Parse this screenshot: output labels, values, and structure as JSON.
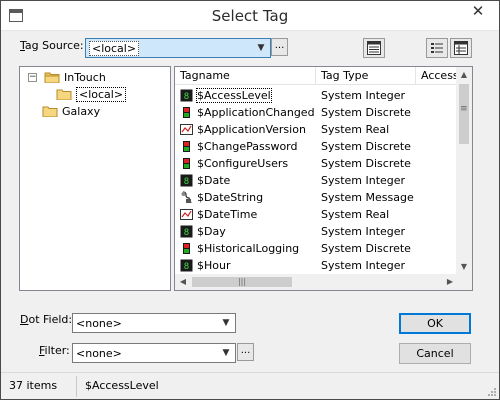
{
  "window": {
    "title": "Select Tag",
    "close_glyph": "✕"
  },
  "tag_source": {
    "label_prefix": "T",
    "label_rest": "ag Source:",
    "value": "<local>",
    "browse_label": "..."
  },
  "tree": {
    "items": [
      {
        "label": "InTouch",
        "expander": "−",
        "icon": "folder-open-icon"
      },
      {
        "label": "<local>",
        "icon": "folder-icon",
        "selected": true
      },
      {
        "label": "Galaxy",
        "icon": "folder-icon"
      }
    ]
  },
  "list": {
    "columns": [
      "Tagname",
      "Tag Type",
      "Access"
    ],
    "rows": [
      {
        "name": "$AccessLevel",
        "type": "System Integer",
        "icon": "integer-tag-icon"
      },
      {
        "name": "$ApplicationChanged",
        "type": "System Discrete",
        "icon": "discrete-tag-icon"
      },
      {
        "name": "$ApplicationVersion",
        "type": "System Real",
        "icon": "real-tag-icon"
      },
      {
        "name": "$ChangePassword",
        "type": "System Discrete",
        "icon": "discrete-tag-icon"
      },
      {
        "name": "$ConfigureUsers",
        "type": "System Discrete",
        "icon": "discrete-tag-icon"
      },
      {
        "name": "$Date",
        "type": "System Integer",
        "icon": "integer-tag-icon"
      },
      {
        "name": "$DateString",
        "type": "System Message",
        "icon": "message-tag-icon"
      },
      {
        "name": "$DateTime",
        "type": "System Real",
        "icon": "real-tag-icon"
      },
      {
        "name": "$Day",
        "type": "System Integer",
        "icon": "integer-tag-icon"
      },
      {
        "name": "$HistoricalLogging",
        "type": "System Discrete",
        "icon": "discrete-tag-icon"
      },
      {
        "name": "$Hour",
        "type": "System Integer",
        "icon": "integer-tag-icon"
      }
    ],
    "selected_index": 0
  },
  "dot_field": {
    "label_prefix": "D",
    "label_rest": "ot Field:",
    "value": "<none>"
  },
  "filter": {
    "label_prefix": "F",
    "label_rest": "ilter:",
    "value": "<none>",
    "browse_label": "..."
  },
  "buttons": {
    "ok": "OK",
    "cancel": "Cancel"
  },
  "status": {
    "count": "37 items",
    "selected": "$AccessLevel"
  },
  "colors": {
    "accent": "#0078d7",
    "combo_highlight": "#cfe7fb"
  }
}
